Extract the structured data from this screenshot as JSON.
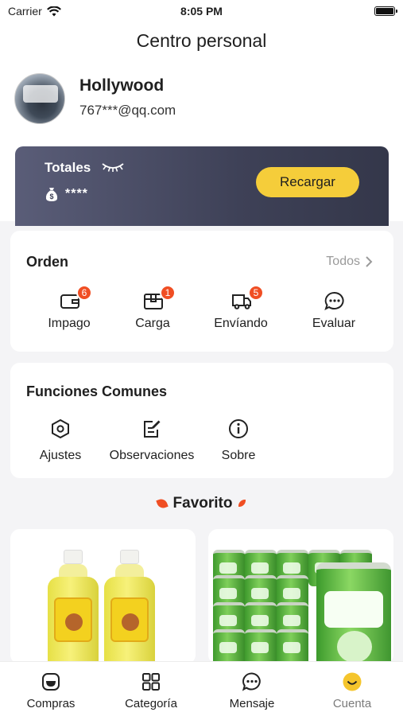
{
  "status_bar": {
    "carrier": "Carrier",
    "time": "8:05 PM"
  },
  "page": {
    "title": "Centro personal"
  },
  "user": {
    "name": "Hollywood",
    "email": "767***@qq.com"
  },
  "wallet": {
    "title": "Totales",
    "amount": "****",
    "recharge_label": "Recargar"
  },
  "orders": {
    "title": "Orden",
    "see_all": "Todos",
    "items": [
      {
        "label": "Impago",
        "badge": "6",
        "icon": "wallet-icon"
      },
      {
        "label": "Carga",
        "badge": "1",
        "icon": "box-icon"
      },
      {
        "label": "Envíando",
        "badge": "5",
        "icon": "truck-icon"
      },
      {
        "label": "Evaluar",
        "badge": "",
        "icon": "chat-bubble-icon"
      }
    ]
  },
  "common_functions": {
    "title": "Funciones Comunes",
    "items": [
      {
        "label": "Ajustes",
        "icon": "settings-hexagon-icon"
      },
      {
        "label": "Observaciones",
        "icon": "edit-note-icon"
      },
      {
        "label": "Sobre",
        "icon": "info-icon"
      }
    ]
  },
  "favorites": {
    "title": "Favorito"
  },
  "tab_bar": {
    "items": [
      {
        "label": "Compras",
        "icon": "shop-bag-icon"
      },
      {
        "label": "Categoría",
        "icon": "grid-icon"
      },
      {
        "label": "Mensaje",
        "icon": "message-icon"
      },
      {
        "label": "Cuenta",
        "icon": "smile-face-icon",
        "active": true
      }
    ]
  },
  "colors": {
    "accent_yellow": "#f5cd3a",
    "badge_red": "#f04e23",
    "wallet_bg": "#3e4157",
    "page_bg": "#f4f4f6"
  }
}
